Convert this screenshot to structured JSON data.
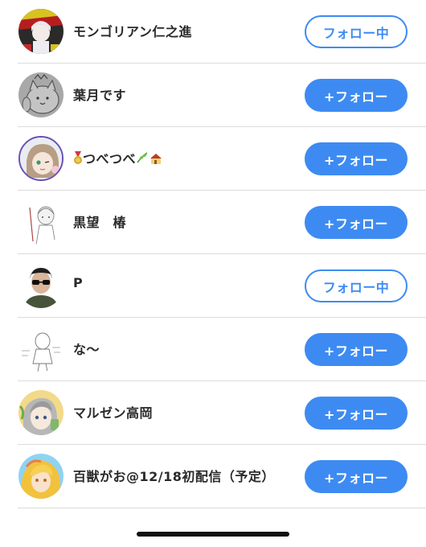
{
  "users": [
    {
      "name": "モンゴリアン仁之進",
      "button_label": "フォロー中",
      "following": true,
      "avatar_icon": "anime-character-avatar-icon"
    },
    {
      "name": "葉月です",
      "button_label": "+フォロー",
      "following": false,
      "avatar_icon": "cat-sketch-avatar-icon"
    },
    {
      "name": "つべつべ",
      "badge_before": "medal-icon",
      "badge_after": "house-plant-icon",
      "button_label": "+フォロー",
      "following": false,
      "avatar_icon": "anime-girl-avatar-icon"
    },
    {
      "name": "黒望　椿",
      "button_label": "+フォロー",
      "following": false,
      "avatar_icon": "sketch-character-avatar-icon"
    },
    {
      "name": "P",
      "button_label": "フォロー中",
      "following": true,
      "avatar_icon": "sunglasses-person-avatar-icon"
    },
    {
      "name": "な〜",
      "button_label": "+フォロー",
      "following": false,
      "avatar_icon": "line-drawing-avatar-icon"
    },
    {
      "name": "マルゼン高岡",
      "button_label": "+フォロー",
      "following": false,
      "avatar_icon": "anime-boy-avatar-icon"
    },
    {
      "name": "百獣がお@12/18初配信（予定）",
      "button_label": "+フォロー",
      "following": false,
      "avatar_icon": "blonde-character-avatar-icon"
    }
  ],
  "colors": {
    "accent": "#3d8bf2",
    "divider": "#dcdcdc"
  }
}
